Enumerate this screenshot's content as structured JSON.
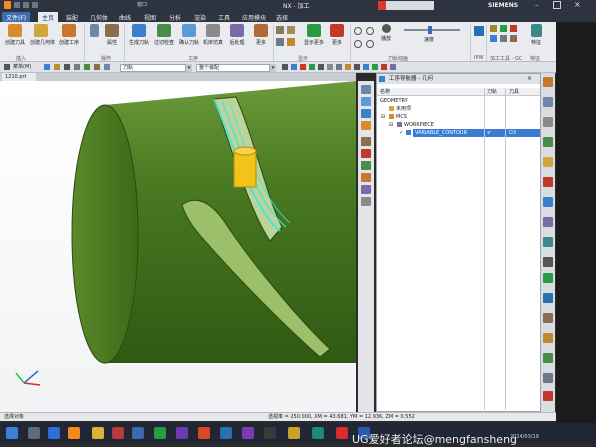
{
  "window": {
    "title": "NX - 加工",
    "brand": "SIEMENS",
    "search_placeholder": "窗口"
  },
  "menu": {
    "items": [
      "文件(F)",
      "主页",
      "装配",
      "几何体",
      "曲线",
      "视图",
      "分析",
      "渲染",
      "工具",
      "应用模块",
      "选择"
    ],
    "active_index": 1
  },
  "ribbon": {
    "buttons": [
      {
        "label": "创建刀具",
        "icon": "create-tool-icon",
        "color": "#d98a2b"
      },
      {
        "label": "创建几何体",
        "icon": "create-geometry-icon",
        "color": "#d0a640"
      },
      {
        "label": "创建工序",
        "icon": "create-operation-icon",
        "color": "#c9772c"
      },
      {
        "label": "程序顺序视图",
        "icon": "view-icon",
        "color": "#6f86a8"
      },
      {
        "label": "属性",
        "icon": "properties-icon",
        "color": "#8a6e4d"
      },
      {
        "label": "生成刀轨",
        "icon": "generate-path-icon",
        "color": "#3c7fcc"
      },
      {
        "label": "过切检查",
        "icon": "gouge-check-icon",
        "color": "#4a8c4a"
      },
      {
        "label": "确认刀轨",
        "icon": "verify-path-icon",
        "color": "#5a9bd8"
      },
      {
        "label": "机床仿真",
        "icon": "machine-sim-icon",
        "color": "#8a8a8a"
      },
      {
        "label": "后处理",
        "icon": "postprocess-icon",
        "color": "#7a6aa8"
      },
      {
        "label": "更多",
        "icon": "more-icon",
        "color": "#b06a3a"
      },
      {
        "label": "显示更多",
        "icon": "show-more-icon",
        "color": "#2a9a44"
      },
      {
        "label": "更多",
        "icon": "more2-icon",
        "color": "#c0392b"
      },
      {
        "label": "播放",
        "icon": "play-icon",
        "color": "#555"
      },
      {
        "label": "速度",
        "icon": "speed-icon",
        "color": "#777"
      },
      {
        "label": "IPW",
        "icon": "ipw-icon",
        "color": "#2a6fb0"
      },
      {
        "label": "工具",
        "icon": "tools-icon",
        "color": "#9a8a30"
      },
      {
        "label": "特征",
        "icon": "feature-icon",
        "color": "#3a8a8a"
      }
    ],
    "groups": [
      "插入",
      "操作",
      "工序",
      "显示",
      "刀轨动画",
      "IPW",
      "加工工具 - GC",
      "特征"
    ]
  },
  "toolbar2": {
    "menu_label": "菜单(M)",
    "filter_value": "刀轨",
    "scope_value": "整个装配"
  },
  "document": {
    "tab_label": "1210.prt"
  },
  "navigator": {
    "title": "工序导航器 - 几何",
    "columns": [
      "名称",
      "刀轨",
      "刀具"
    ],
    "rows": [
      {
        "name": "GEOMETRY",
        "path": "",
        "tool": "",
        "indent": 0,
        "selected": false
      },
      {
        "name": "未用项",
        "path": "",
        "tool": "",
        "indent": 1,
        "selected": false
      },
      {
        "name": "MCS",
        "path": "",
        "tool": "",
        "indent": 1,
        "selected": false
      },
      {
        "name": "WORKPIECE",
        "path": "",
        "tool": "",
        "indent": 2,
        "selected": false
      },
      {
        "name": "VARIABLE_CONTOUR",
        "path": "✔",
        "tool": "D3",
        "indent": 3,
        "selected": true
      }
    ]
  },
  "status": {
    "text": "选择对象",
    "coords": "透视率 = 250.000, XM = 43.681, YM = 12.936, ZM = 0.552"
  },
  "watermark": "UG爱好者论坛@mengfansheng",
  "taskbar": {
    "clock": "2024/03/19"
  }
}
